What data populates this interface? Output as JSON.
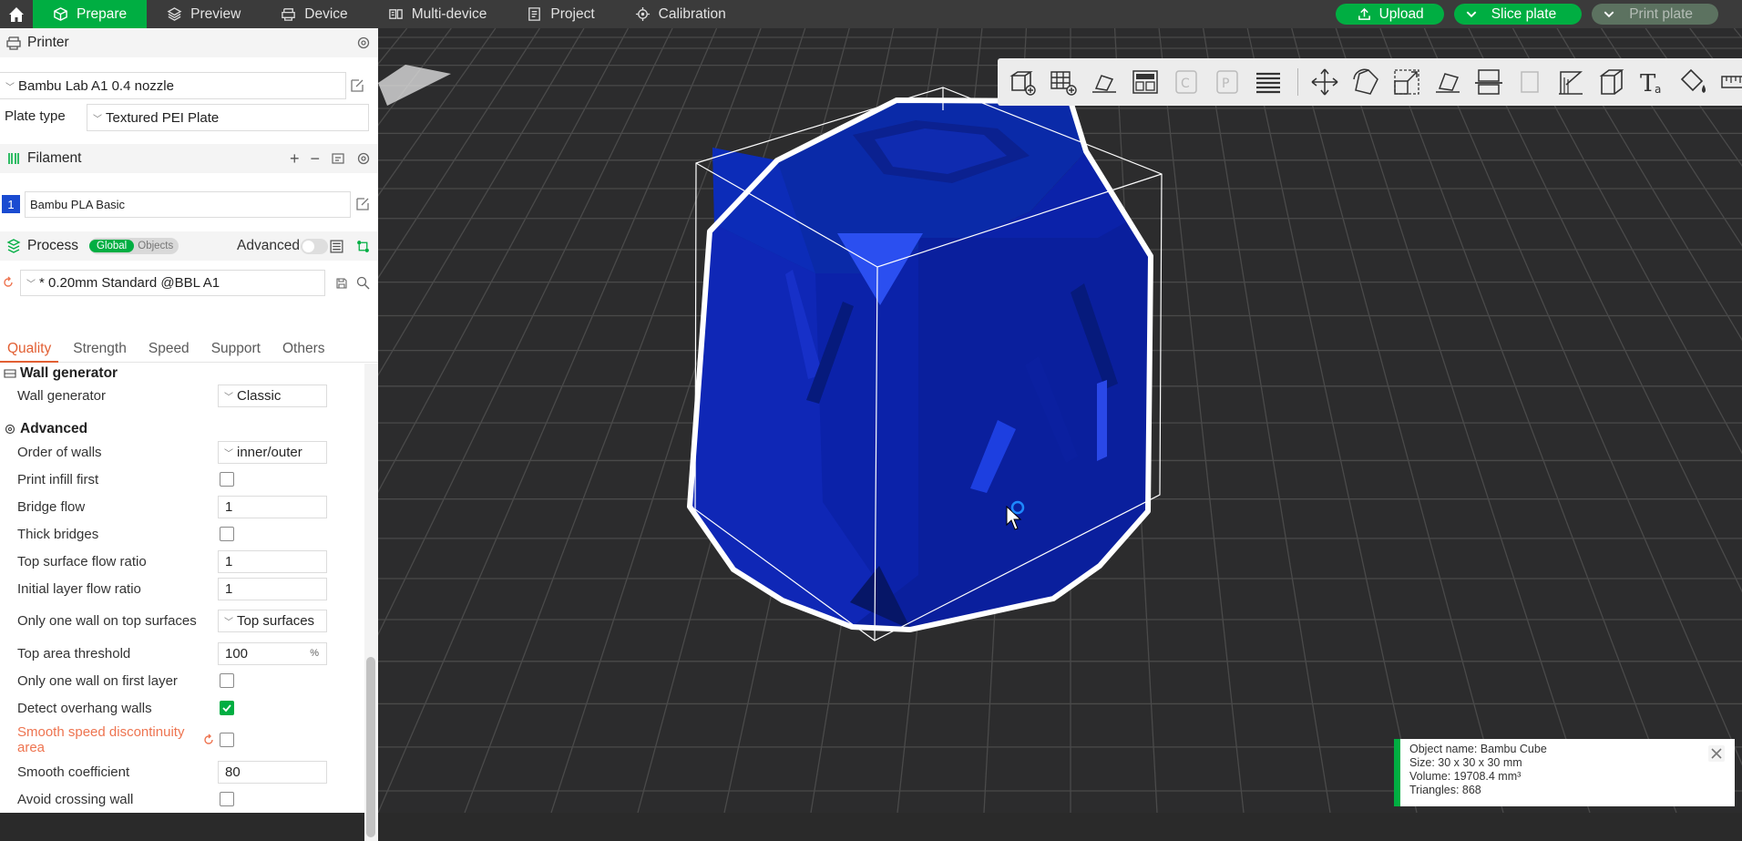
{
  "topbar": {
    "tabs": [
      {
        "label": "Prepare",
        "icon": "cube-icon",
        "active": true
      },
      {
        "label": "Preview",
        "icon": "layers-icon"
      },
      {
        "label": "Device",
        "icon": "printer-icon"
      },
      {
        "label": "Multi-device",
        "icon": "multi-device-icon"
      },
      {
        "label": "Project",
        "icon": "project-icon"
      },
      {
        "label": "Calibration",
        "icon": "calibration-icon"
      }
    ],
    "upload": "Upload",
    "slice": "Slice plate",
    "print": "Print plate"
  },
  "printer": {
    "title": "Printer",
    "name": "Bambu Lab A1 0.4 nozzle",
    "plate_label": "Plate type",
    "plate_value": "Textured PEI Plate"
  },
  "filament": {
    "title": "Filament",
    "slot": "1",
    "name": "Bambu PLA Basic",
    "slot_color": "#1a4bd1"
  },
  "process": {
    "title": "Process",
    "global": "Global",
    "objects": "Objects",
    "advanced": "Advanced",
    "preset": "* 0.20mm Standard @BBL A1"
  },
  "tabs": [
    "Quality",
    "Strength",
    "Speed",
    "Support",
    "Others"
  ],
  "settings": {
    "wall_generator_group": "Wall generator",
    "wall_generator_label": "Wall generator",
    "wall_generator_value": "Classic",
    "advanced_group": "Advanced",
    "order_of_walls_label": "Order of walls",
    "order_of_walls_value": "inner/outer",
    "print_infill_first": "Print infill first",
    "bridge_flow_label": "Bridge flow",
    "bridge_flow_value": "1",
    "thick_bridges": "Thick bridges",
    "top_surface_flow_label": "Top surface flow ratio",
    "top_surface_flow_value": "1",
    "initial_layer_flow_label": "Initial layer flow ratio",
    "initial_layer_flow_value": "1",
    "one_wall_top_label": "Only one wall on top surfaces",
    "one_wall_top_value": "Top surfaces",
    "top_area_threshold_label": "Top area threshold",
    "top_area_threshold_value": "100",
    "top_area_threshold_unit": "%",
    "one_wall_first_layer": "Only one wall on first layer",
    "detect_overhang": "Detect overhang walls",
    "smooth_speed_label": "Smooth speed discontinuity area",
    "smooth_coef_label": "Smooth coefficient",
    "smooth_coef_value": "80",
    "avoid_crossing": "Avoid crossing wall"
  },
  "object_info": {
    "name": "Object name: Bambu Cube",
    "size": "Size: 30 x 30 x 30 mm",
    "volume": "Volume: 19708.4 mm³",
    "triangles": "Triangles: 868"
  },
  "colors": {
    "accent": "#00ae42",
    "modified": "#ee7450",
    "model": "#0d2bb8"
  }
}
